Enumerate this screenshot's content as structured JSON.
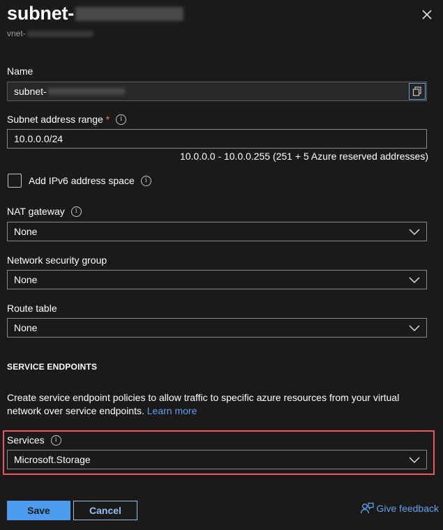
{
  "header": {
    "title_prefix": "subnet-",
    "subtitle_prefix": "vnet-",
    "close_icon": "close-icon"
  },
  "name_field": {
    "label": "Name",
    "value_prefix": "subnet-",
    "copy_icon": "copy-icon"
  },
  "subnet_range": {
    "label": "Subnet address range",
    "required_mark": "*",
    "value": "10.0.0.0/24",
    "note": "10.0.0.0 - 10.0.0.255 (251 + 5 Azure reserved addresses)"
  },
  "ipv6": {
    "label": "Add IPv6 address space",
    "checked": false
  },
  "nat_gateway": {
    "label": "NAT gateway",
    "selected": "None"
  },
  "nsg": {
    "label": "Network security group",
    "selected": "None"
  },
  "route_table": {
    "label": "Route table",
    "selected": "None"
  },
  "service_endpoints": {
    "heading": "SERVICE ENDPOINTS",
    "description": "Create service endpoint policies to allow traffic to specific azure resources from your virtual network over service endpoints.",
    "learn_more": "Learn more",
    "services_label": "Services",
    "services_selected": "Microsoft.Storage"
  },
  "footer": {
    "save_label": "Save",
    "cancel_label": "Cancel",
    "feedback_label": "Give feedback"
  },
  "colors": {
    "background": "#1b1a19",
    "accent": "#4c9bef",
    "link": "#5ea0ef",
    "highlight": "#e45a5a",
    "required": "#f1707b"
  }
}
